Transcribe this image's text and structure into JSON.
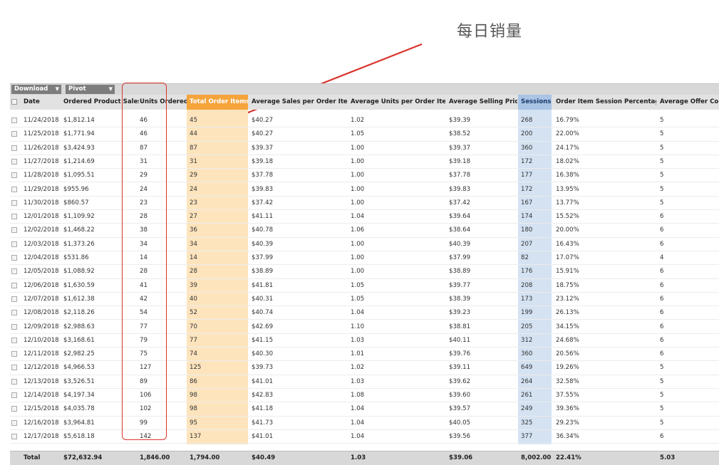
{
  "annotation": {
    "text": "每日销量",
    "color": "#d9342b"
  },
  "toolbar": {
    "download_label": "Download",
    "pivot_label": "Pivot"
  },
  "headers": [
    "Date",
    "Ordered Product Sales",
    "Units Ordered",
    "Total Order Items",
    "Average Sales per Order Item",
    "Average Units per Order Item",
    "Average Selling Price",
    "Sessions",
    "Order Item Session Percentage",
    "Average Offer Count"
  ],
  "rows": [
    [
      "11/24/2018",
      "$1,812.14",
      "46",
      "45",
      "$40.27",
      "1.02",
      "$39.39",
      "268",
      "16.79%",
      "5"
    ],
    [
      "11/25/2018",
      "$1,771.94",
      "46",
      "44",
      "$40.27",
      "1.05",
      "$38.52",
      "200",
      "22.00%",
      "5"
    ],
    [
      "11/26/2018",
      "$3,424.93",
      "87",
      "87",
      "$39.37",
      "1.00",
      "$39.37",
      "360",
      "24.17%",
      "5"
    ],
    [
      "11/27/2018",
      "$1,214.69",
      "31",
      "31",
      "$39.18",
      "1.00",
      "$39.18",
      "172",
      "18.02%",
      "5"
    ],
    [
      "11/28/2018",
      "$1,095.51",
      "29",
      "29",
      "$37.78",
      "1.00",
      "$37.78",
      "177",
      "16.38%",
      "5"
    ],
    [
      "11/29/2018",
      "$955.96",
      "24",
      "24",
      "$39.83",
      "1.00",
      "$39.83",
      "172",
      "13.95%",
      "5"
    ],
    [
      "11/30/2018",
      "$860.57",
      "23",
      "23",
      "$37.42",
      "1.00",
      "$37.42",
      "167",
      "13.77%",
      "5"
    ],
    [
      "12/01/2018",
      "$1,109.92",
      "28",
      "27",
      "$41.11",
      "1.04",
      "$39.64",
      "174",
      "15.52%",
      "6"
    ],
    [
      "12/02/2018",
      "$1,468.22",
      "38",
      "36",
      "$40.78",
      "1.06",
      "$38.64",
      "180",
      "20.00%",
      "6"
    ],
    [
      "12/03/2018",
      "$1,373.26",
      "34",
      "34",
      "$40.39",
      "1.00",
      "$40.39",
      "207",
      "16.43%",
      "6"
    ],
    [
      "12/04/2018",
      "$531.86",
      "14",
      "14",
      "$37.99",
      "1.00",
      "$37.99",
      "82",
      "17.07%",
      "4"
    ],
    [
      "12/05/2018",
      "$1,088.92",
      "28",
      "28",
      "$38.89",
      "1.00",
      "$38.89",
      "176",
      "15.91%",
      "6"
    ],
    [
      "12/06/2018",
      "$1,630.59",
      "41",
      "39",
      "$41.81",
      "1.05",
      "$39.77",
      "208",
      "18.75%",
      "6"
    ],
    [
      "12/07/2018",
      "$1,612.38",
      "42",
      "40",
      "$40.31",
      "1.05",
      "$38.39",
      "173",
      "23.12%",
      "6"
    ],
    [
      "12/08/2018",
      "$2,118.26",
      "54",
      "52",
      "$40.74",
      "1.04",
      "$39.23",
      "199",
      "26.13%",
      "6"
    ],
    [
      "12/09/2018",
      "$2,988.63",
      "77",
      "70",
      "$42.69",
      "1.10",
      "$38.81",
      "205",
      "34.15%",
      "6"
    ],
    [
      "12/10/2018",
      "$3,168.61",
      "79",
      "77",
      "$41.15",
      "1.03",
      "$40.11",
      "312",
      "24.68%",
      "6"
    ],
    [
      "12/11/2018",
      "$2,982.25",
      "75",
      "74",
      "$40.30",
      "1.01",
      "$39.76",
      "360",
      "20.56%",
      "6"
    ],
    [
      "12/12/2018",
      "$4,966.53",
      "127",
      "125",
      "$39.73",
      "1.02",
      "$39.11",
      "649",
      "19.26%",
      "5"
    ],
    [
      "12/13/2018",
      "$3,526.51",
      "89",
      "86",
      "$41.01",
      "1.03",
      "$39.62",
      "264",
      "32.58%",
      "5"
    ],
    [
      "12/14/2018",
      "$4,197.34",
      "106",
      "98",
      "$42.83",
      "1.08",
      "$39.60",
      "261",
      "37.55%",
      "5"
    ],
    [
      "12/15/2018",
      "$4,035.78",
      "102",
      "98",
      "$41.18",
      "1.04",
      "$39.57",
      "249",
      "39.36%",
      "5"
    ],
    [
      "12/16/2018",
      "$3,964.81",
      "99",
      "95",
      "$41.73",
      "1.04",
      "$40.05",
      "325",
      "29.23%",
      "5"
    ],
    [
      "12/17/2018",
      "$5,618.18",
      "142",
      "137",
      "$41.01",
      "1.04",
      "$39.56",
      "377",
      "36.34%",
      "6"
    ]
  ],
  "totals": [
    "Total",
    "$72,632.94",
    "1,846.00",
    "1,794.00",
    "$40.49",
    "1.03",
    "$39.06",
    "8,002.00",
    "22.41%",
    "5.03"
  ],
  "colors": {
    "orange_header": "#f5a43c",
    "orange_col": "#fde4bd",
    "blue_header": "#a9c4e4",
    "blue_col": "#d4e2f2",
    "highlight_box": "#d9342b"
  }
}
